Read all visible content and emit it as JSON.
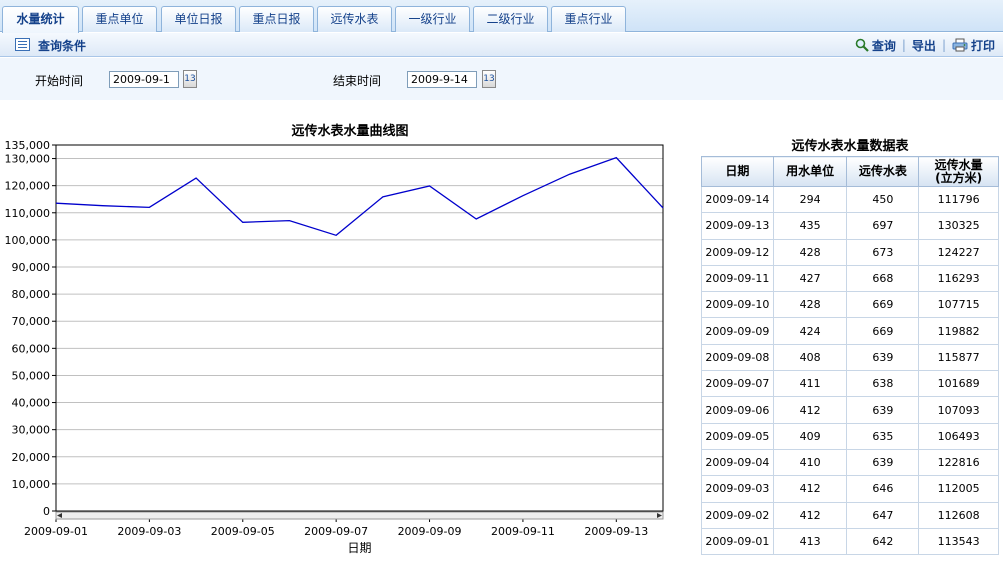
{
  "tabs": [
    {
      "label": "水量统计",
      "active": true
    },
    {
      "label": "重点单位",
      "active": false
    },
    {
      "label": "单位日报",
      "active": false
    },
    {
      "label": "重点日报",
      "active": false
    },
    {
      "label": "远传水表",
      "active": false
    },
    {
      "label": "一级行业",
      "active": false
    },
    {
      "label": "二级行业",
      "active": false
    },
    {
      "label": "重点行业",
      "active": false
    }
  ],
  "query_bar": {
    "title": "查询条件",
    "search_label": "查询",
    "export_label": "导出",
    "print_label": "打印",
    "separator": "|"
  },
  "filter": {
    "start_label": "开始时间",
    "start_value": "2009-09-1",
    "end_label": "结束时间",
    "end_value": "2009-9-14",
    "calendar_icon_text": "13"
  },
  "colors": {
    "line": "#0000cc",
    "tab_text": "#15428b"
  },
  "chart_data": {
    "type": "line",
    "title": "远传水表水量曲线图",
    "xlabel": "日期",
    "ylabel": "",
    "ylim": [
      0,
      135000
    ],
    "yticks": [
      0,
      10000,
      20000,
      30000,
      40000,
      50000,
      60000,
      70000,
      80000,
      90000,
      100000,
      110000,
      120000,
      130000,
      135000
    ],
    "ytick_labels": [
      "0",
      "10,000",
      "20,000",
      "30,000",
      "40,000",
      "50,000",
      "60,000",
      "70,000",
      "80,000",
      "90,000",
      "100,000",
      "110,000",
      "120,000",
      "130,000",
      "135,000"
    ],
    "grid": true,
    "x": [
      "2009-09-01",
      "2009-09-02",
      "2009-09-03",
      "2009-09-04",
      "2009-09-05",
      "2009-09-06",
      "2009-09-07",
      "2009-09-08",
      "2009-09-09",
      "2009-09-10",
      "2009-09-11",
      "2009-09-12",
      "2009-09-13",
      "2009-09-14"
    ],
    "xtick_labels": [
      "2009-09-01",
      "2009-09-03",
      "2009-09-05",
      "2009-09-07",
      "2009-09-09",
      "2009-09-11",
      "2009-09-13"
    ],
    "series": [
      {
        "values": [
          113543,
          112608,
          112005,
          122816,
          106493,
          107093,
          101689,
          115877,
          119882,
          107715,
          116293,
          124227,
          130325,
          111796
        ]
      }
    ]
  },
  "table": {
    "title": "远传水表水量数据表",
    "headers": [
      "日期",
      "用水单位",
      "远传水表",
      "远传水量(立方米)"
    ],
    "header_line1": [
      "日期",
      "用水单位",
      "远传水表",
      "远传水量"
    ],
    "header_line2": [
      "",
      "",
      "",
      "(立方米)"
    ],
    "rows": [
      [
        "2009-09-14",
        "294",
        "450",
        "111796"
      ],
      [
        "2009-09-13",
        "435",
        "697",
        "130325"
      ],
      [
        "2009-09-12",
        "428",
        "673",
        "124227"
      ],
      [
        "2009-09-11",
        "427",
        "668",
        "116293"
      ],
      [
        "2009-09-10",
        "428",
        "669",
        "107715"
      ],
      [
        "2009-09-09",
        "424",
        "669",
        "119882"
      ],
      [
        "2009-09-08",
        "408",
        "639",
        "115877"
      ],
      [
        "2009-09-07",
        "411",
        "638",
        "101689"
      ],
      [
        "2009-09-06",
        "412",
        "639",
        "107093"
      ],
      [
        "2009-09-05",
        "409",
        "635",
        "106493"
      ],
      [
        "2009-09-04",
        "410",
        "639",
        "122816"
      ],
      [
        "2009-09-03",
        "412",
        "646",
        "112005"
      ],
      [
        "2009-09-02",
        "412",
        "647",
        "112608"
      ],
      [
        "2009-09-01",
        "413",
        "642",
        "113543"
      ]
    ]
  }
}
